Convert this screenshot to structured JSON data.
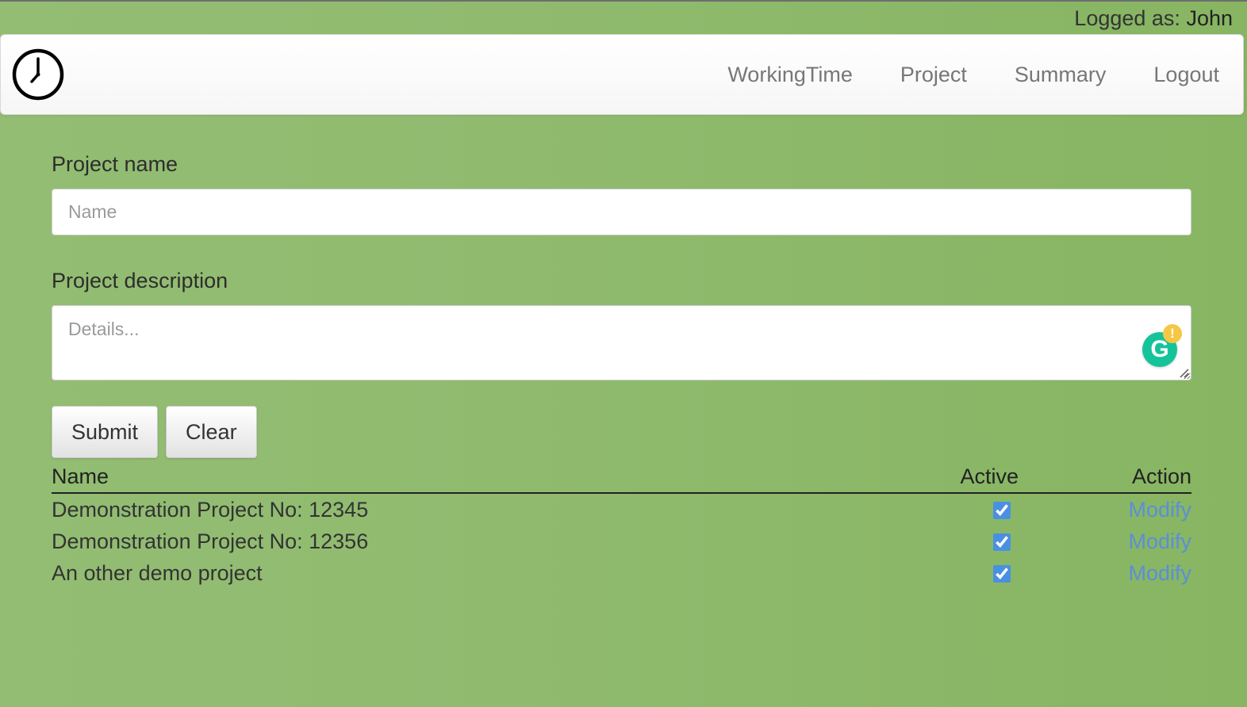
{
  "user_bar": {
    "prefix": "Logged as:",
    "user_name": "John"
  },
  "navbar": {
    "logo_icon": "clock-icon",
    "links": [
      {
        "label": "WorkingTime"
      },
      {
        "label": "Project"
      },
      {
        "label": "Summary"
      },
      {
        "label": "Logout"
      }
    ]
  },
  "form": {
    "name_label": "Project name",
    "name_value": "",
    "name_placeholder": "Name",
    "description_label": "Project description",
    "description_value": "",
    "description_placeholder": "Details...",
    "grammarly_icon": "grammarly-icon",
    "grammarly_letter": "G",
    "grammarly_alert": "!",
    "submit_label": "Submit",
    "clear_label": "Clear"
  },
  "table": {
    "headers": {
      "name": "Name",
      "active": "Active",
      "action": "Action"
    },
    "rows": [
      {
        "name": "Demonstration Project No: 12345",
        "active": true,
        "action": "Modify"
      },
      {
        "name": "Demonstration Project No: 12356",
        "active": true,
        "action": "Modify"
      },
      {
        "name": "An other demo project",
        "active": true,
        "action": "Modify"
      }
    ]
  },
  "colors": {
    "background": "#8fba6c",
    "link": "#5b8fd6",
    "checkbox": "#4a90e2",
    "grammarly": "#15c39a",
    "grammarly_alert": "#f6c745"
  }
}
